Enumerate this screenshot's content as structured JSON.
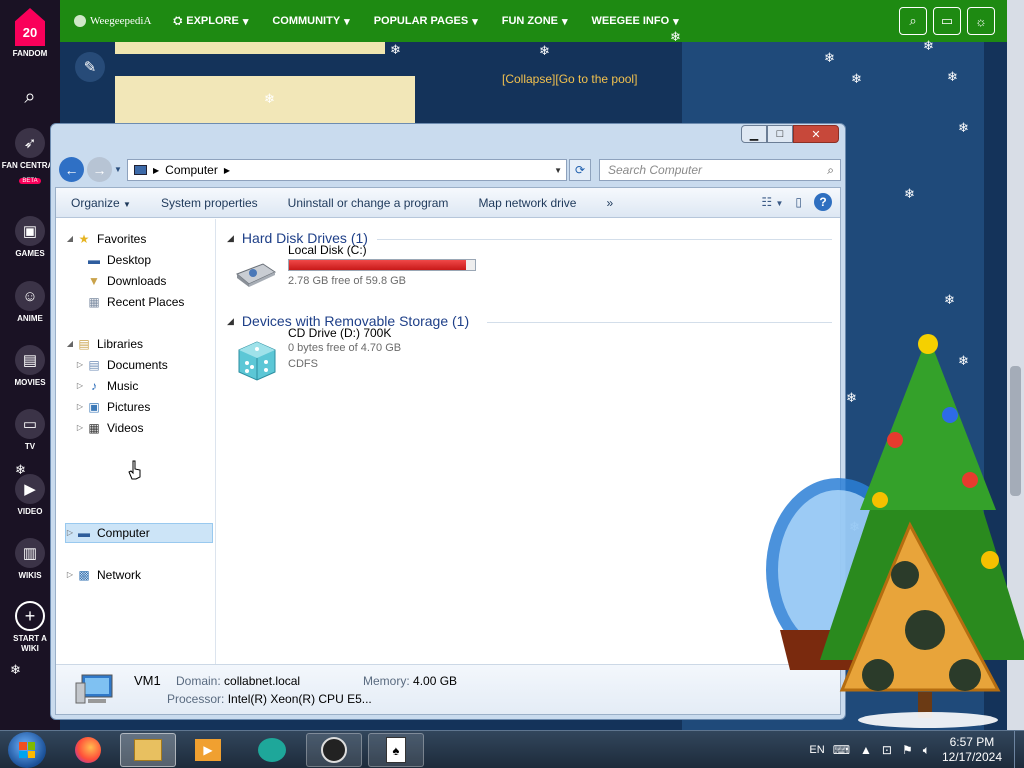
{
  "fandom_rail": {
    "logo_badge": "20",
    "logo_label": "FANDOM",
    "items": [
      {
        "label": "FAN CENTRAL",
        "badge": "BETA",
        "icon": "rocket-icon"
      },
      {
        "label": "GAMES",
        "icon": "gamepad-icon"
      },
      {
        "label": "ANIME",
        "icon": "anime-icon"
      },
      {
        "label": "MOVIES",
        "icon": "clapper-icon"
      },
      {
        "label": "TV",
        "icon": "tv-icon"
      },
      {
        "label": "VIDEO",
        "icon": "play-icon"
      },
      {
        "label": "WIKIS",
        "icon": "book-icon"
      },
      {
        "label": "START A WIKI",
        "icon": "plus-icon"
      }
    ]
  },
  "wiki_nav": {
    "site_name": "WeegeepediA",
    "items": [
      "EXPLORE",
      "COMMUNITY",
      "POPULAR PAGES",
      "FUN ZONE",
      "WEEGEE INFO"
    ],
    "collapse_link": "[Collapse]",
    "pool_link": "[Go to the pool]"
  },
  "window": {
    "address": "Computer",
    "search_placeholder": "Search Computer",
    "toolbar": {
      "organize": "Organize",
      "system_properties": "System properties",
      "uninstall": "Uninstall or change a program",
      "map_drive": "Map network drive",
      "more": "»"
    },
    "nav": {
      "favorites": "Favorites",
      "desktop": "Desktop",
      "downloads": "Downloads",
      "recent": "Recent Places",
      "libraries": "Libraries",
      "documents": "Documents",
      "music": "Music",
      "pictures": "Pictures",
      "videos": "Videos",
      "computer": "Computer",
      "network": "Network"
    },
    "groups": {
      "hdd_header": "Hard Disk Drives (1)",
      "removable_header": "Devices with Removable Storage (1)"
    },
    "drives": {
      "c_name": "Local Disk (C:)",
      "c_free": "2.78 GB free of 59.8 GB",
      "c_used_fraction": 0.954,
      "d_name": "CD Drive (D:) 700K",
      "d_free": "0 bytes free of 4.70 GB",
      "d_fs": "CDFS"
    },
    "details": {
      "name": "VM1",
      "domain_label": "Domain:",
      "domain": "collabnet.local",
      "memory_label": "Memory:",
      "memory": "4.00 GB",
      "processor_label": "Processor:",
      "processor": "Intel(R) Xeon(R) CPU E5..."
    }
  },
  "taskbar": {
    "language": "EN",
    "time": "6:57 PM",
    "date": "12/17/2024"
  },
  "colors": {
    "wiki_green": "#1e8a12",
    "fandom_pink": "#fa005a",
    "drive_bar_red": "#d42020",
    "link_gold": "#f2c14e"
  }
}
